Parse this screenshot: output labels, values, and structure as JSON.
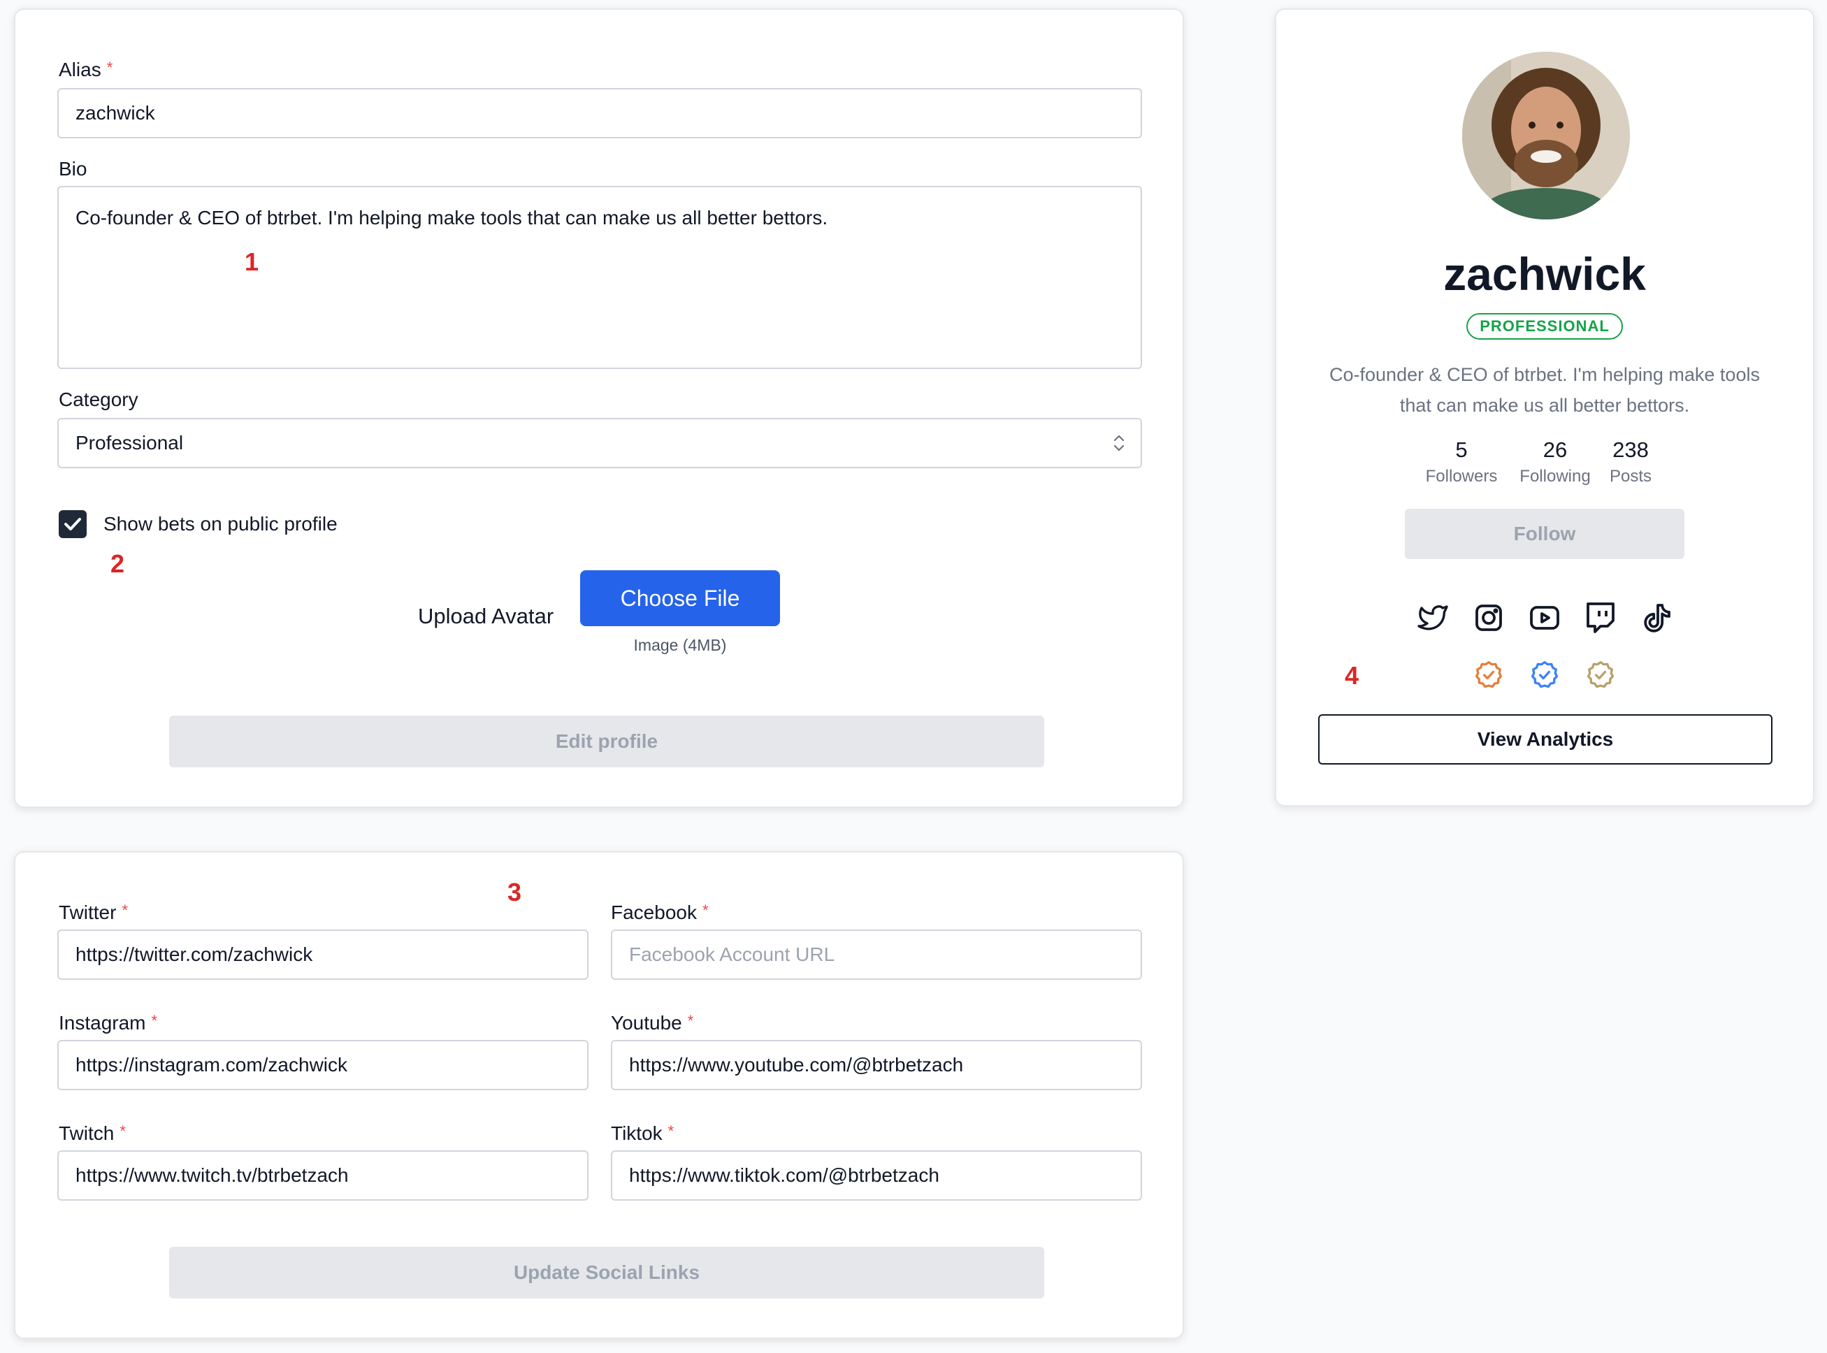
{
  "profile_form": {
    "alias": {
      "label": "Alias",
      "required_mark": "*",
      "value": "zachwick"
    },
    "bio": {
      "label": "Bio",
      "value": "Co-founder & CEO of btrbet. I'm helping make tools that can make us all better bettors."
    },
    "category": {
      "label": "Category",
      "value": "Professional"
    },
    "show_bets": {
      "label": "Show bets on public profile",
      "checked": true
    },
    "upload": {
      "label": "Upload Avatar",
      "button": "Choose File",
      "hint": "Image (4MB)"
    },
    "submit": "Edit profile"
  },
  "social_form": {
    "twitter": {
      "label": "Twitter",
      "required_mark": "*",
      "value": "https://twitter.com/zachwick",
      "placeholder": ""
    },
    "facebook": {
      "label": "Facebook",
      "required_mark": "*",
      "value": "",
      "placeholder": "Facebook Account URL"
    },
    "instagram": {
      "label": "Instagram",
      "required_mark": "*",
      "value": "https://instagram.com/zachwick",
      "placeholder": ""
    },
    "youtube": {
      "label": "Youtube",
      "required_mark": "*",
      "value": "https://www.youtube.com/@btrbetzach",
      "placeholder": ""
    },
    "twitch": {
      "label": "Twitch",
      "required_mark": "*",
      "value": "https://www.twitch.tv/btrbetzach",
      "placeholder": ""
    },
    "tiktok": {
      "label": "Tiktok",
      "required_mark": "*",
      "value": "https://www.tiktok.com/@btrbetzach",
      "placeholder": ""
    },
    "submit": "Update Social Links"
  },
  "profile_card": {
    "username": "zachwick",
    "badge": "PROFESSIONAL",
    "bio_line1": "Co-founder & CEO of btrbet. I'm helping make tools",
    "bio_line2": "that can make us all better bettors.",
    "stats": [
      {
        "value": "5",
        "label": "Followers"
      },
      {
        "value": "26",
        "label": "Following"
      },
      {
        "value": "238",
        "label": "Posts"
      }
    ],
    "follow_button": "Follow",
    "social_icons": [
      "twitter-icon",
      "instagram-icon",
      "youtube-icon",
      "twitch-icon",
      "tiktok-icon"
    ],
    "verified_badges": [
      {
        "name": "orange-verified-badge-icon",
        "color": "#e67e3a"
      },
      {
        "name": "blue-verified-badge-icon",
        "color": "#3b82f6"
      },
      {
        "name": "gold-verified-badge-icon",
        "color": "#b8a06a"
      }
    ],
    "analytics_button": "View Analytics"
  },
  "annotations": [
    "1",
    "2",
    "3",
    "4"
  ],
  "colors": {
    "primary": "#2563eb",
    "badge_green": "#16a34a",
    "required": "#ef4444",
    "annotation": "#dc2626"
  }
}
